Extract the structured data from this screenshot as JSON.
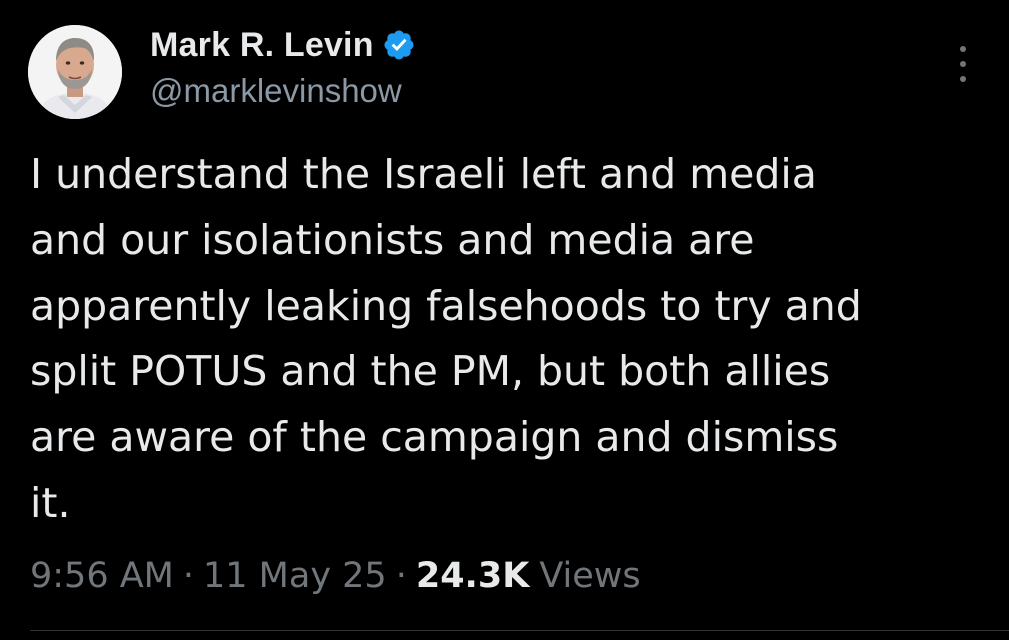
{
  "author": {
    "display_name": "Mark R. Levin",
    "handle": "@marklevinshow",
    "verified": true,
    "verified_color": "#1d9bf0",
    "avatar_icon": "profile-photo"
  },
  "menu": {
    "icon": "more-options-icon"
  },
  "tweet": {
    "text": "I understand the Israeli left and media and our isolationists and media are apparently leaking falsehoods to try and split POTUS and the PM, but both allies are aware of the campaign and dismiss it.",
    "lines": [
      "I understand the Israeli left and media",
      "and our isolationists and media are",
      "apparently leaking falsehoods to try and",
      "split POTUS and the PM, but both allies",
      "are aware of the campaign and dismiss",
      "it."
    ]
  },
  "meta": {
    "time": "9:56 AM",
    "separator": "·",
    "date": "11 May 25",
    "views_count": "24.3K",
    "views_label": "Views"
  },
  "colors": {
    "background": "#000000",
    "primary_text": "#e7e9ea",
    "secondary_text": "#71767b",
    "accent": "#1d9bf0"
  }
}
